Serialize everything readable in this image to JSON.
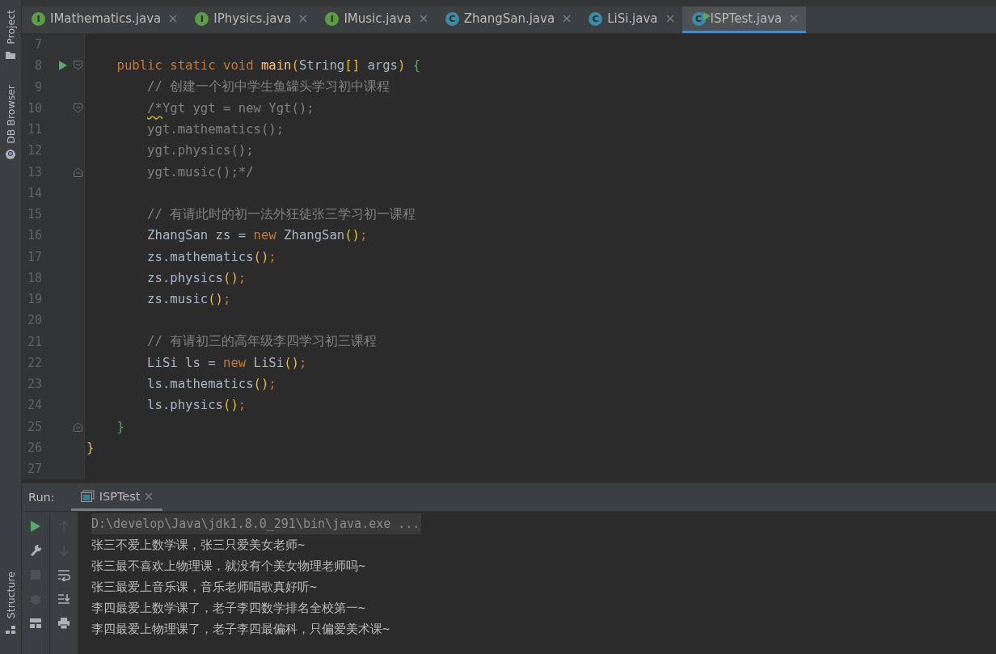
{
  "tool_stripe": {
    "top": [
      {
        "label": "Project",
        "kind": "folder"
      },
      {
        "label": "DB Browser",
        "kind": "database"
      }
    ],
    "bottom": [
      {
        "label": "Structure",
        "kind": "structure"
      }
    ]
  },
  "tabs": [
    {
      "label": "IMathematics.java",
      "badge": "I",
      "kind": "interface",
      "selected": false,
      "runnable": false
    },
    {
      "label": "IPhysics.java",
      "badge": "I",
      "kind": "interface",
      "selected": false,
      "runnable": false
    },
    {
      "label": "IMusic.java",
      "badge": "I",
      "kind": "interface",
      "selected": false,
      "runnable": false
    },
    {
      "label": "ZhangSan.java",
      "badge": "C",
      "kind": "class",
      "selected": false,
      "runnable": false
    },
    {
      "label": "LiSi.java",
      "badge": "C",
      "kind": "class",
      "selected": false,
      "runnable": false
    },
    {
      "label": "ISPTest.java",
      "badge": "C",
      "kind": "class",
      "selected": true,
      "runnable": true
    }
  ],
  "editor": {
    "lines": [
      {
        "number": "7",
        "runnable": false,
        "fold_start": false,
        "fold_end": false
      },
      {
        "number": "8",
        "runnable": true,
        "fold_start": true,
        "fold_end": false,
        "tokens": [
          {
            "kind": "keyword",
            "text": "    public static void "
          },
          {
            "kind": "method",
            "text": "main"
          },
          {
            "kind": "bracket1",
            "text": "("
          },
          {
            "kind": "plain",
            "text": "String"
          },
          {
            "kind": "bracket1",
            "text": "[]"
          },
          {
            "kind": "plain",
            "text": " args"
          },
          {
            "kind": "bracket1",
            "text": ")"
          },
          {
            "kind": "bracket2",
            "text": " {"
          }
        ]
      },
      {
        "number": "9",
        "runnable": false,
        "fold_start": false,
        "fold_end": false,
        "tokens": [
          {
            "kind": "comment",
            "text": "        // 创建一个初中学生鱼罐头学习初中课程"
          }
        ]
      },
      {
        "number": "10",
        "runnable": false,
        "fold_start": true,
        "fold_end": false,
        "tokens": [
          {
            "kind": "comment-warning",
            "text": "        /*"
          },
          {
            "kind": "comment",
            "text": "Ygt ygt = new Ygt();"
          }
        ]
      },
      {
        "number": "11",
        "runnable": false,
        "fold_start": false,
        "fold_end": false,
        "tokens": [
          {
            "kind": "comment",
            "text": "        ygt.mathematics();"
          }
        ]
      },
      {
        "number": "12",
        "runnable": false,
        "fold_start": false,
        "fold_end": false,
        "tokens": [
          {
            "kind": "comment",
            "text": "        ygt.physics();"
          }
        ]
      },
      {
        "number": "13",
        "runnable": false,
        "fold_start": false,
        "fold_end": true,
        "tokens": [
          {
            "kind": "comment",
            "text": "        ygt.music();*/"
          }
        ]
      },
      {
        "number": "14",
        "runnable": false,
        "fold_start": false,
        "fold_end": false
      },
      {
        "number": "15",
        "runnable": false,
        "fold_start": false,
        "fold_end": false,
        "tokens": [
          {
            "kind": "comment",
            "text": "        // 有请此时的初一法外狂徒张三学习初一课程"
          }
        ]
      },
      {
        "number": "16",
        "runnable": false,
        "fold_start": false,
        "fold_end": false,
        "tokens": [
          {
            "kind": "plain",
            "text": "        ZhangSan zs = "
          },
          {
            "kind": "keyword",
            "text": "new"
          },
          {
            "kind": "plain",
            "text": " ZhangSan"
          },
          {
            "kind": "bracket1",
            "text": "()"
          },
          {
            "kind": "keyword",
            "text": ";"
          }
        ]
      },
      {
        "number": "17",
        "runnable": false,
        "fold_start": false,
        "fold_end": false,
        "tokens": [
          {
            "kind": "plain",
            "text": "        zs.mathematics"
          },
          {
            "kind": "bracket1",
            "text": "()"
          },
          {
            "kind": "keyword",
            "text": ";"
          }
        ]
      },
      {
        "number": "18",
        "runnable": false,
        "fold_start": false,
        "fold_end": false,
        "tokens": [
          {
            "kind": "plain",
            "text": "        zs.physics"
          },
          {
            "kind": "bracket1",
            "text": "()"
          },
          {
            "kind": "keyword",
            "text": ";"
          }
        ]
      },
      {
        "number": "19",
        "runnable": false,
        "fold_start": false,
        "fold_end": false,
        "tokens": [
          {
            "kind": "plain",
            "text": "        zs.music"
          },
          {
            "kind": "bracket1",
            "text": "()"
          },
          {
            "kind": "keyword",
            "text": ";"
          }
        ]
      },
      {
        "number": "20",
        "runnable": false,
        "fold_start": false,
        "fold_end": false
      },
      {
        "number": "21",
        "runnable": false,
        "fold_start": false,
        "fold_end": false,
        "tokens": [
          {
            "kind": "comment",
            "text": "        // 有请初三的高年级李四学习初三课程"
          }
        ]
      },
      {
        "number": "22",
        "runnable": false,
        "fold_start": false,
        "fold_end": false,
        "tokens": [
          {
            "kind": "plain",
            "text": "        LiSi ls = "
          },
          {
            "kind": "keyword",
            "text": "new"
          },
          {
            "kind": "plain",
            "text": " LiSi"
          },
          {
            "kind": "bracket1",
            "text": "()"
          },
          {
            "kind": "keyword",
            "text": ";"
          }
        ]
      },
      {
        "number": "23",
        "runnable": false,
        "fold_start": false,
        "fold_end": false,
        "tokens": [
          {
            "kind": "plain",
            "text": "        ls.mathematics"
          },
          {
            "kind": "bracket1",
            "text": "()"
          },
          {
            "kind": "keyword",
            "text": ";"
          }
        ]
      },
      {
        "number": "24",
        "runnable": false,
        "fold_start": false,
        "fold_end": false,
        "tokens": [
          {
            "kind": "plain",
            "text": "        ls.physics"
          },
          {
            "kind": "bracket1",
            "text": "()"
          },
          {
            "kind": "keyword",
            "text": ";"
          }
        ]
      },
      {
        "number": "25",
        "runnable": false,
        "fold_start": false,
        "fold_end": true,
        "tokens": [
          {
            "kind": "bracket2",
            "text": "    }"
          }
        ]
      },
      {
        "number": "26",
        "runnable": false,
        "fold_start": false,
        "fold_end": false,
        "tokens": [
          {
            "kind": "bracket1",
            "text": "}"
          }
        ]
      },
      {
        "number": "27",
        "runnable": false,
        "fold_start": false,
        "fold_end": false
      }
    ]
  },
  "run_panel": {
    "label": "Run:",
    "tabs": [
      {
        "label": "ISPTest",
        "selected": true
      }
    ],
    "toolbar": [
      {
        "kind": "run",
        "disabled": false
      },
      {
        "kind": "wrench",
        "disabled": false
      },
      {
        "kind": "stop",
        "disabled": true
      },
      {
        "kind": "bug",
        "disabled": true
      },
      {
        "kind": "layout",
        "disabled": false
      }
    ],
    "toolbar_2": [
      {
        "kind": "up",
        "disabled": true
      },
      {
        "kind": "down",
        "disabled": true
      },
      {
        "kind": "wrap",
        "disabled": false
      },
      {
        "kind": "scroll-end",
        "disabled": false
      },
      {
        "kind": "print",
        "disabled": false
      }
    ],
    "console": [
      {
        "kind": "command",
        "text": "D:\\develop\\Java\\jdk1.8.0_291\\bin\\java.exe ..."
      },
      {
        "kind": "output",
        "text": "张三不爱上数学课，张三只爱美女老师~"
      },
      {
        "kind": "output",
        "text": "张三最不喜欢上物理课，就没有个美女物理老师吗~"
      },
      {
        "kind": "output",
        "text": "张三最爱上音乐课，音乐老师唱歌真好听~"
      },
      {
        "kind": "output",
        "text": "李四最爱上数学课了，老子李四数学排名全校第一~"
      },
      {
        "kind": "output",
        "text": "李四最爱上物理课了，老子李四最偏科，只偏爱美术课~"
      }
    ]
  }
}
